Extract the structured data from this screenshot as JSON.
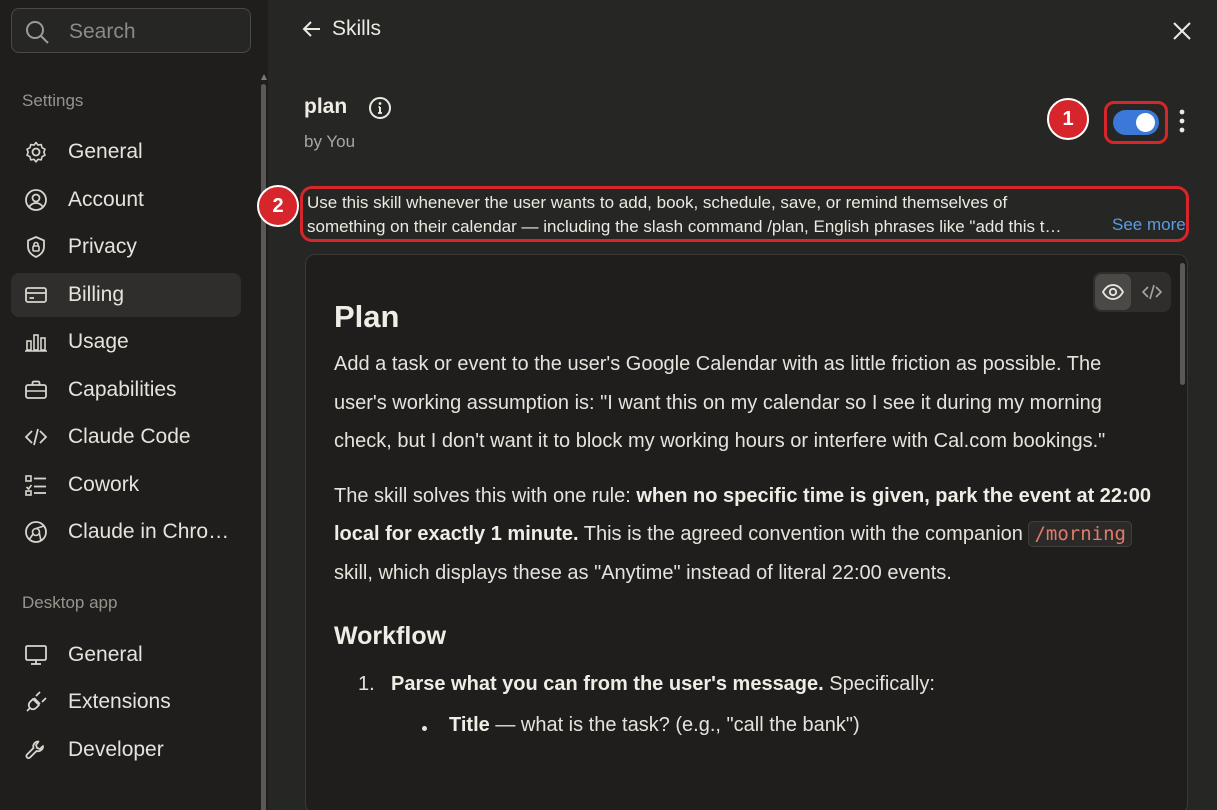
{
  "search": {
    "placeholder": "Search"
  },
  "sidebar": {
    "settings_label": "Settings",
    "settings_items": [
      {
        "label": "General",
        "icon": "gear-icon"
      },
      {
        "label": "Account",
        "icon": "user-circle-icon"
      },
      {
        "label": "Privacy",
        "icon": "shield-lock-icon"
      },
      {
        "label": "Billing",
        "icon": "credit-card-icon",
        "active": true
      },
      {
        "label": "Usage",
        "icon": "bar-chart-icon"
      },
      {
        "label": "Capabilities",
        "icon": "briefcase-icon"
      },
      {
        "label": "Claude Code",
        "icon": "code-icon"
      },
      {
        "label": "Cowork",
        "icon": "checklist-icon"
      },
      {
        "label": "Claude in Chro…",
        "icon": "globe-icon"
      }
    ],
    "desktop_label": "Desktop app",
    "desktop_items": [
      {
        "label": "General",
        "icon": "monitor-icon"
      },
      {
        "label": "Extensions",
        "icon": "plug-icon"
      },
      {
        "label": "Developer",
        "icon": "wrench-icon"
      }
    ]
  },
  "header": {
    "back_label": "Skills"
  },
  "skill": {
    "name": "plan",
    "author": "by You",
    "enabled": true,
    "description_line1": "Use this skill whenever the user wants to add, book, schedule, save, or remind themselves of",
    "description_line2": "something on their calendar — including the slash command /plan, English phrases like \"add this t…",
    "see_more": "See more"
  },
  "annotations": {
    "badge1": "1",
    "badge2": "2"
  },
  "doc": {
    "title": "Plan",
    "intro": "Add a task or event to the user's Google Calendar with as little friction as possible. The user's working assumption is: \"I want this on my calendar so I see it during my morning check, but I don't want it to block my working hours or interfere with Cal.com bookings.\"",
    "rule_prefix": "The skill solves this with one rule: ",
    "rule_bold": "when no specific time is given, park the event at 22:00 local for exactly 1 minute.",
    "rule_suffix": " This is the agreed convention with the companion ",
    "rule_code": "/morning",
    "rule_end": " skill, which displays these as \"Anytime\" instead of literal 22:00 events.",
    "workflow_heading": "Workflow",
    "step1_num": "1.",
    "step1_bold": "Parse what you can from the user's message.",
    "step1_rest": " Specifically:",
    "bullet1_bold": "Title",
    "bullet1_rest": " — what is the task? (e.g., \"call the bank\")"
  }
}
